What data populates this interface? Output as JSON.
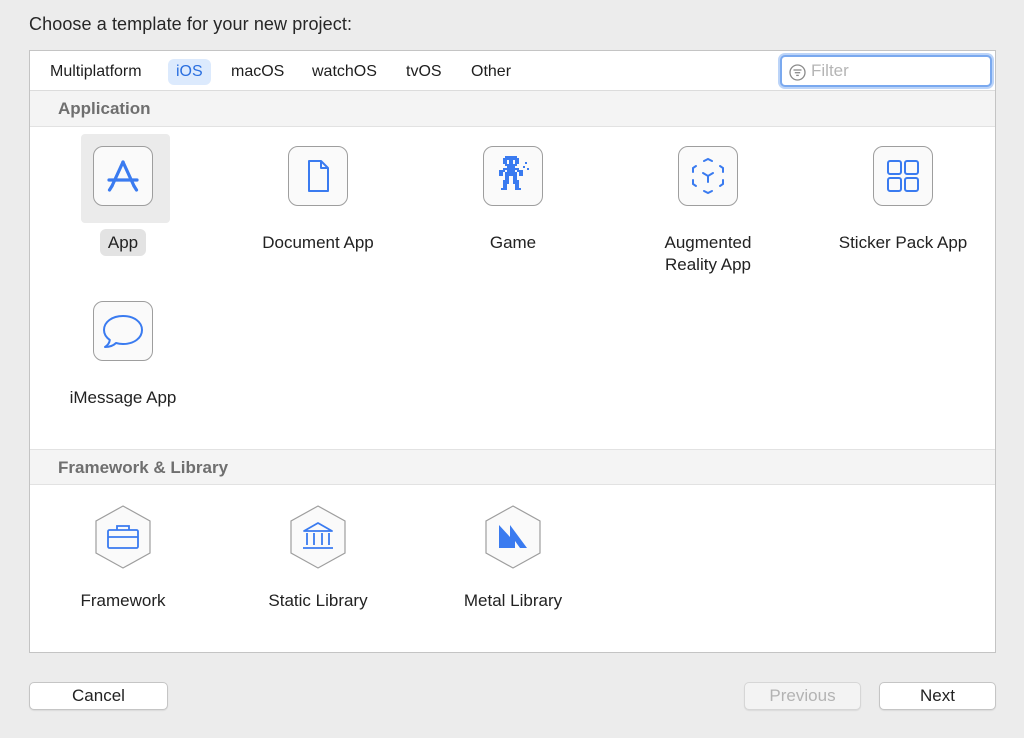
{
  "dialog": {
    "heading": "Choose a template for your new project:"
  },
  "tabs": [
    {
      "label": "Multiplatform",
      "active": false
    },
    {
      "label": "iOS",
      "active": true
    },
    {
      "label": "macOS",
      "active": false
    },
    {
      "label": "watchOS",
      "active": false
    },
    {
      "label": "tvOS",
      "active": false
    },
    {
      "label": "Other",
      "active": false
    }
  ],
  "filter": {
    "placeholder": "Filter",
    "value": ""
  },
  "sections": {
    "application": {
      "title": "Application",
      "templates": [
        {
          "label": "App",
          "icon": "app-store-icon",
          "selected": true
        },
        {
          "label": "Document App",
          "icon": "document-icon",
          "selected": false
        },
        {
          "label": "Game",
          "icon": "game-sprite-icon",
          "selected": false
        },
        {
          "label": "Augmented\nReality App",
          "icon": "ar-cube-icon",
          "selected": false
        },
        {
          "label": "Sticker Pack App",
          "icon": "grid-icon",
          "selected": false
        },
        {
          "label": "iMessage App",
          "icon": "speech-bubble-icon",
          "selected": false
        }
      ]
    },
    "framework": {
      "title": "Framework & Library",
      "templates": [
        {
          "label": "Framework",
          "icon": "toolbox-icon"
        },
        {
          "label": "Static Library",
          "icon": "building-icon"
        },
        {
          "label": "Metal Library",
          "icon": "metal-icon"
        }
      ]
    }
  },
  "buttons": {
    "cancel": "Cancel",
    "previous": "Previous",
    "next": "Next"
  },
  "colors": {
    "accent": "#3478f6",
    "active_tab_bg": "#dceafd",
    "active_tab_text": "#2a6fe0",
    "focus_ring": "#7aa9ef"
  }
}
